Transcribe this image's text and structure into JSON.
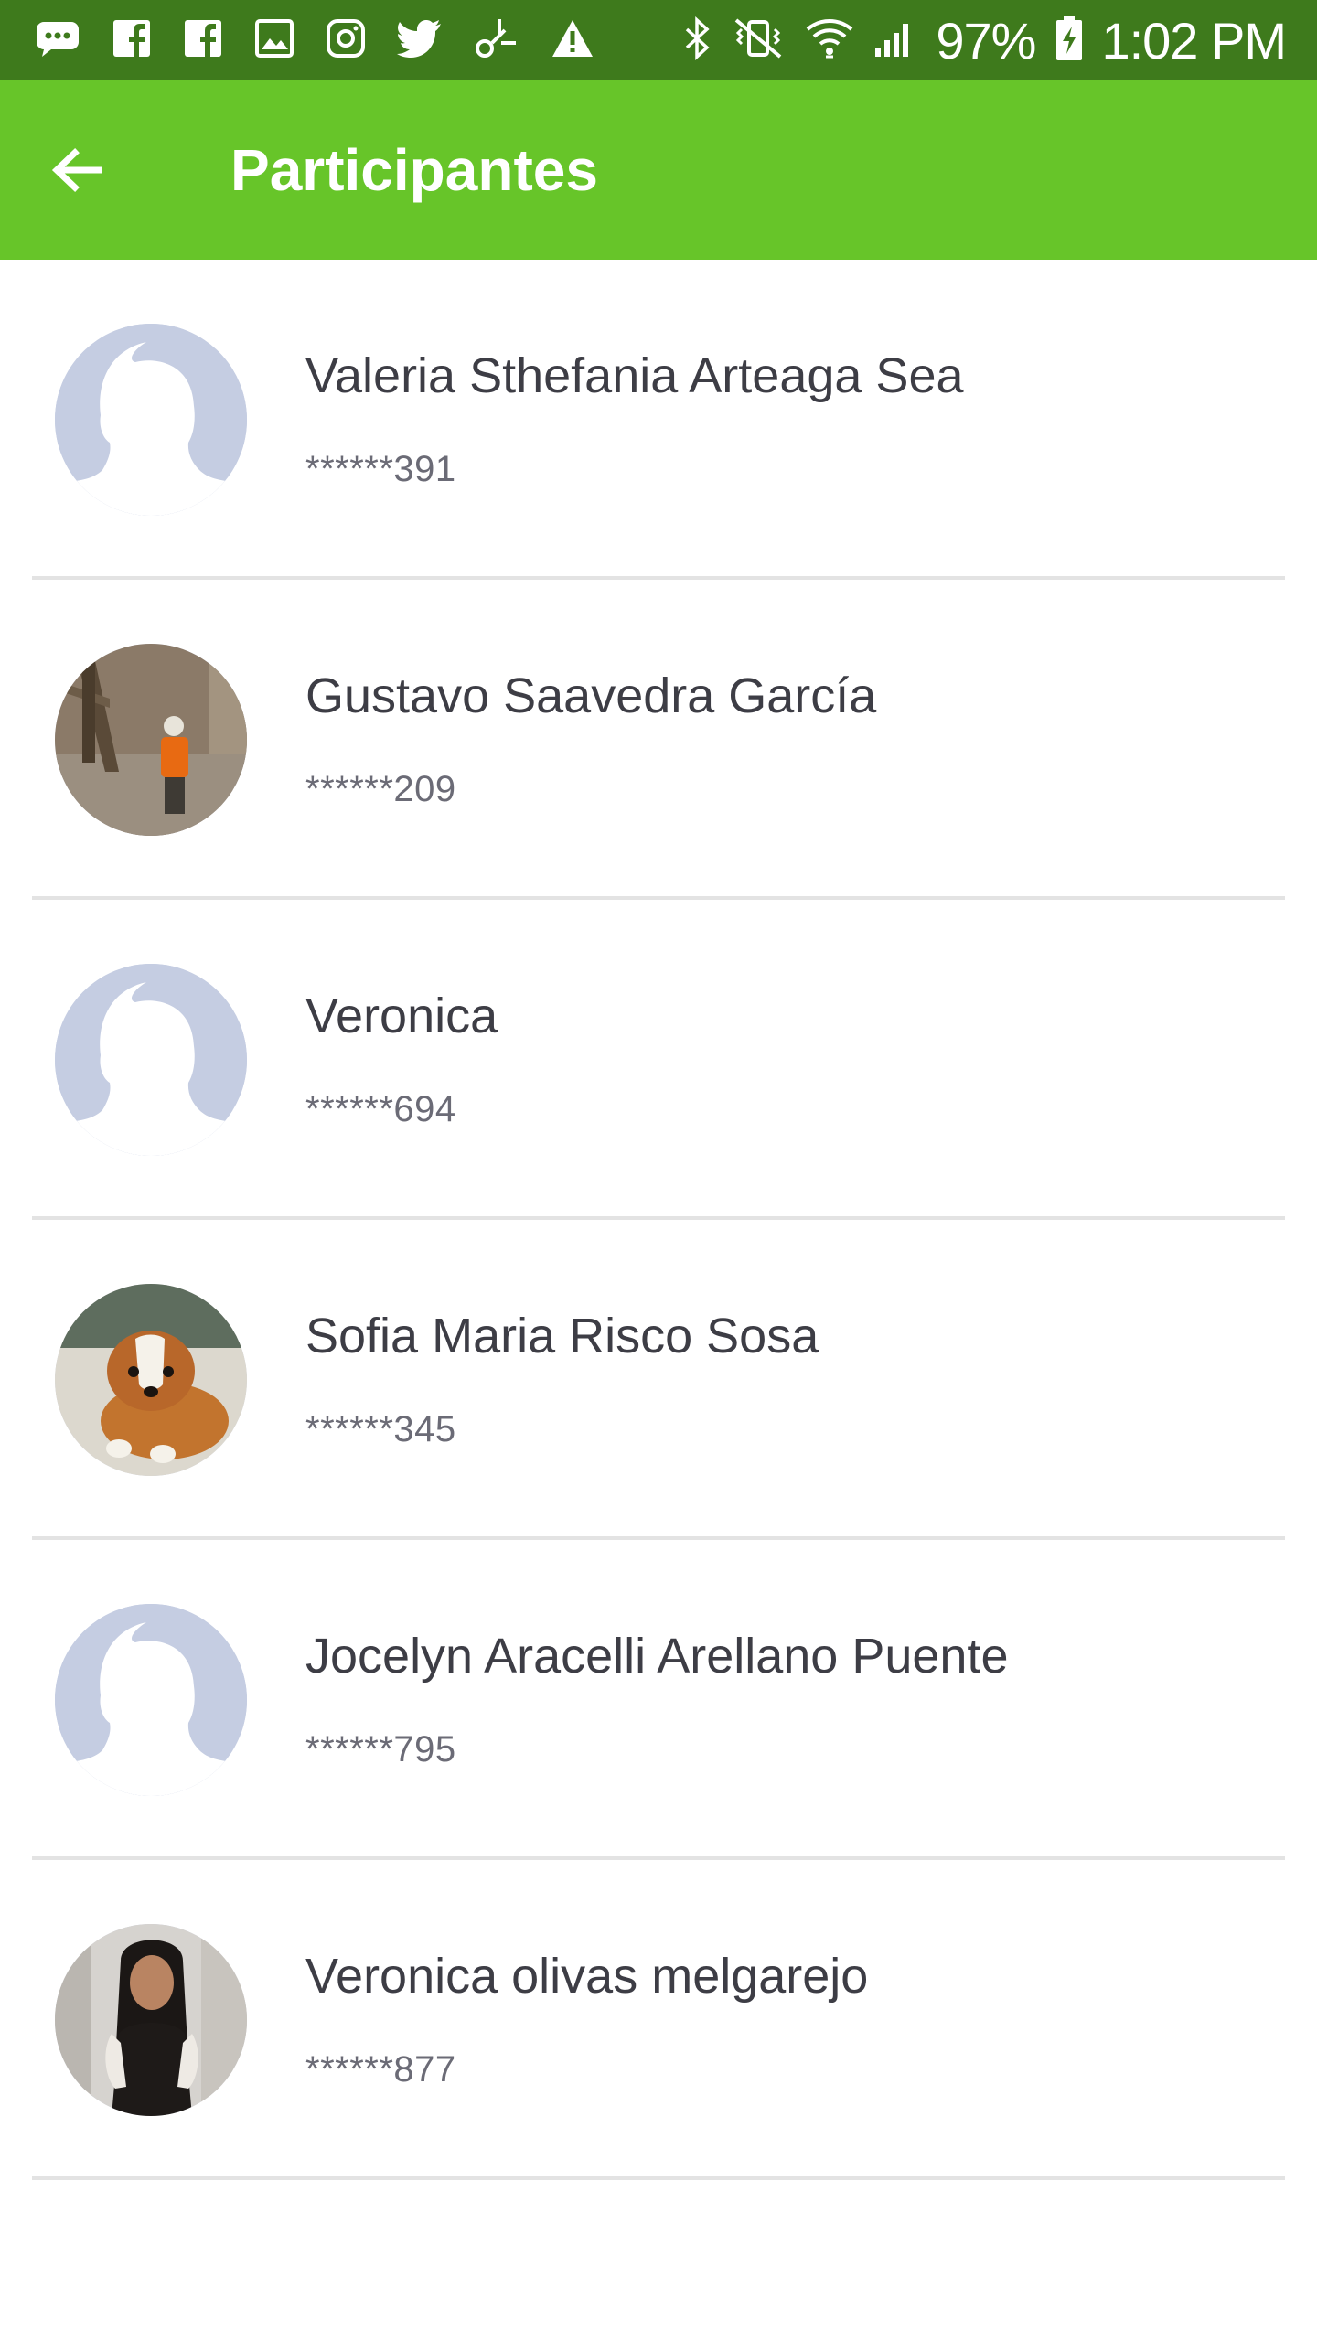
{
  "status_bar": {
    "battery": "97%",
    "time": "1:02 PM",
    "notification_icons": [
      "message-icon",
      "facebook-icon",
      "facebook-icon",
      "image-icon",
      "instagram-icon",
      "twitter-icon",
      "app-icon",
      "warning-icon"
    ],
    "system_icons": [
      "bluetooth-icon",
      "vibrate-icon",
      "wifi-icon",
      "signal-icon",
      "battery-charging-icon"
    ]
  },
  "appbar": {
    "title": "Participantes",
    "back_icon": "arrow-back-icon",
    "color": "#67c529"
  },
  "participants": [
    {
      "name": "Valeria Sthefania Arteaga Sea",
      "phone": "******391",
      "avatar": "default-avatar"
    },
    {
      "name": "Gustavo Saavedra García",
      "phone": "******209",
      "avatar": "photo-man-hardhat"
    },
    {
      "name": "Veronica",
      "phone": "******694",
      "avatar": "default-avatar"
    },
    {
      "name": "Sofia Maria Risco Sosa",
      "phone": "******345",
      "avatar": "photo-puppy"
    },
    {
      "name": "Jocelyn Aracelli Arellano Puente",
      "phone": "******795",
      "avatar": "default-avatar"
    },
    {
      "name": "Veronica olivas melgarejo",
      "phone": "******877",
      "avatar": "photo-woman"
    }
  ]
}
